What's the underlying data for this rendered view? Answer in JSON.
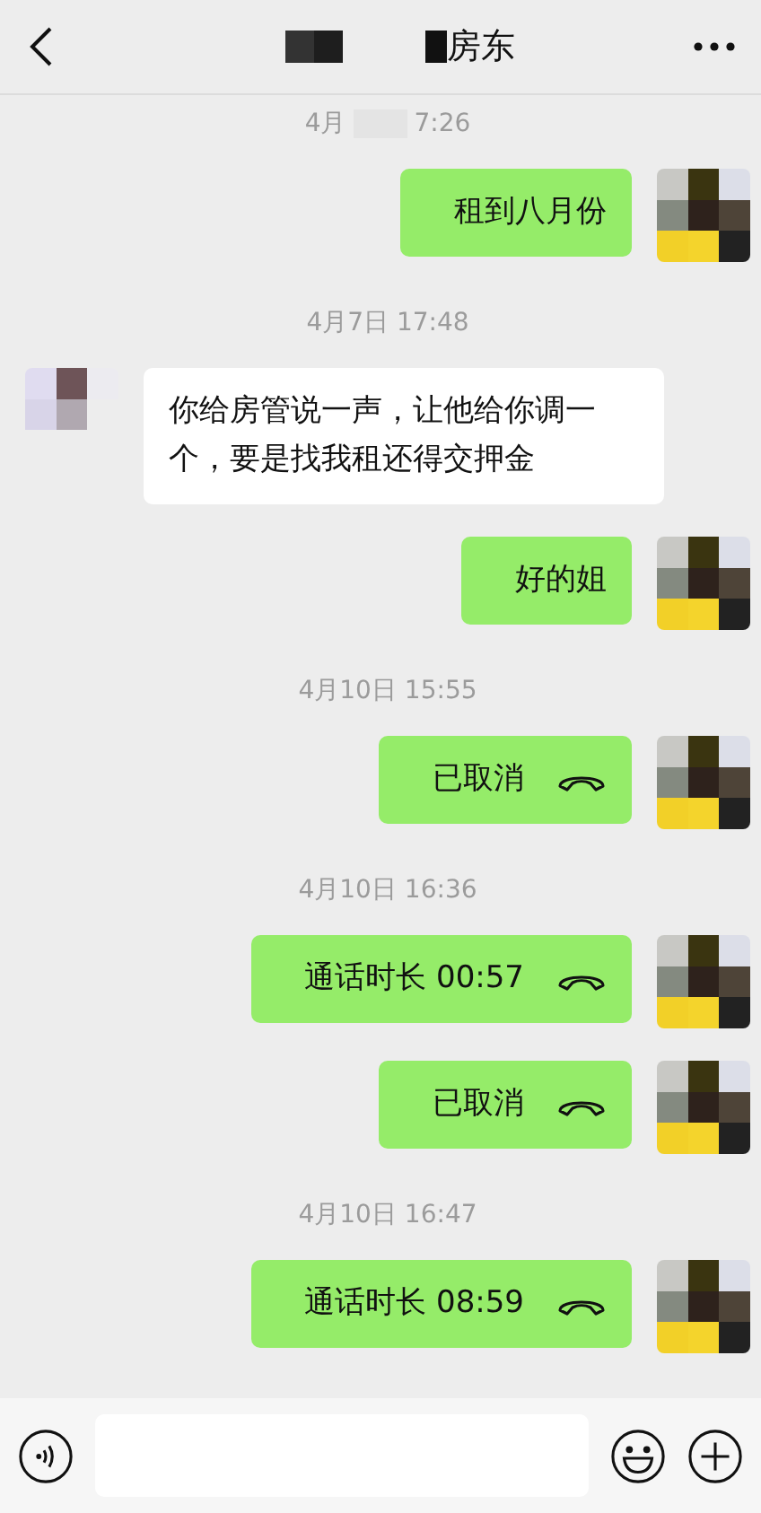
{
  "header": {
    "title": "房东"
  },
  "messages": [
    {
      "kind": "time",
      "parts": [
        "4月",
        "7:26"
      ]
    },
    {
      "kind": "text",
      "outgoing": true,
      "text": "租到八月份"
    },
    {
      "kind": "time",
      "parts": [
        "4月7日 17:48"
      ]
    },
    {
      "kind": "text",
      "outgoing": false,
      "text": "你给房管说一声，让他给你调一个，要是找我租还得交押金"
    },
    {
      "kind": "text",
      "outgoing": true,
      "text": "好的姐"
    },
    {
      "kind": "time",
      "parts": [
        "4月10日 15:55"
      ]
    },
    {
      "kind": "call",
      "outgoing": true,
      "text": "已取消"
    },
    {
      "kind": "time",
      "parts": [
        "4月10日 16:36"
      ]
    },
    {
      "kind": "call",
      "outgoing": true,
      "text": "通话时长 00:57"
    },
    {
      "kind": "call",
      "outgoing": true,
      "text": "已取消"
    },
    {
      "kind": "time",
      "parts": [
        "4月10日 16:47"
      ]
    },
    {
      "kind": "call",
      "outgoing": true,
      "text": "通话时长 08:59"
    }
  ]
}
